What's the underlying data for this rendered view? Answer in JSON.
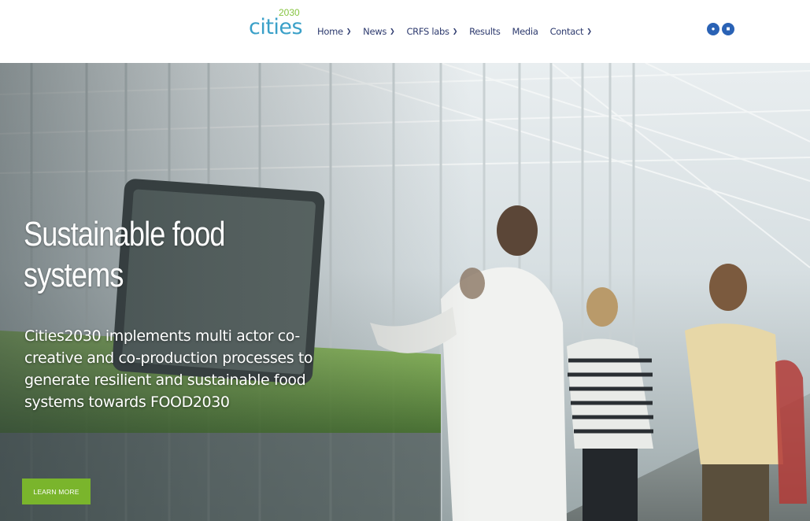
{
  "logo": {
    "word": "cities",
    "year": "2030"
  },
  "nav": {
    "items": [
      {
        "label": "Home",
        "dropdown": true
      },
      {
        "label": "News",
        "dropdown": true
      },
      {
        "label": "CRFS labs",
        "dropdown": true
      },
      {
        "label": "Results",
        "dropdown": false
      },
      {
        "label": "Media",
        "dropdown": false
      },
      {
        "label": "Contact",
        "dropdown": true
      }
    ]
  },
  "social": [
    {
      "icon": "circle-social-icon"
    },
    {
      "icon": "square-social-icon"
    }
  ],
  "hero": {
    "title_line1": "Sustainable food",
    "title_line2": "systems",
    "body": "Cities2030 implements multi actor co-creative and co-production processes to generate resilient and sustainable food systems towards FOOD2030",
    "button_label": "LEARN MORE"
  },
  "colors": {
    "brand_blue": "#3aa0c8",
    "brand_green": "#86c440",
    "nav_text": "#2d3a6e",
    "social_blue": "#2a62b5",
    "button_green": "#7ab52c"
  }
}
